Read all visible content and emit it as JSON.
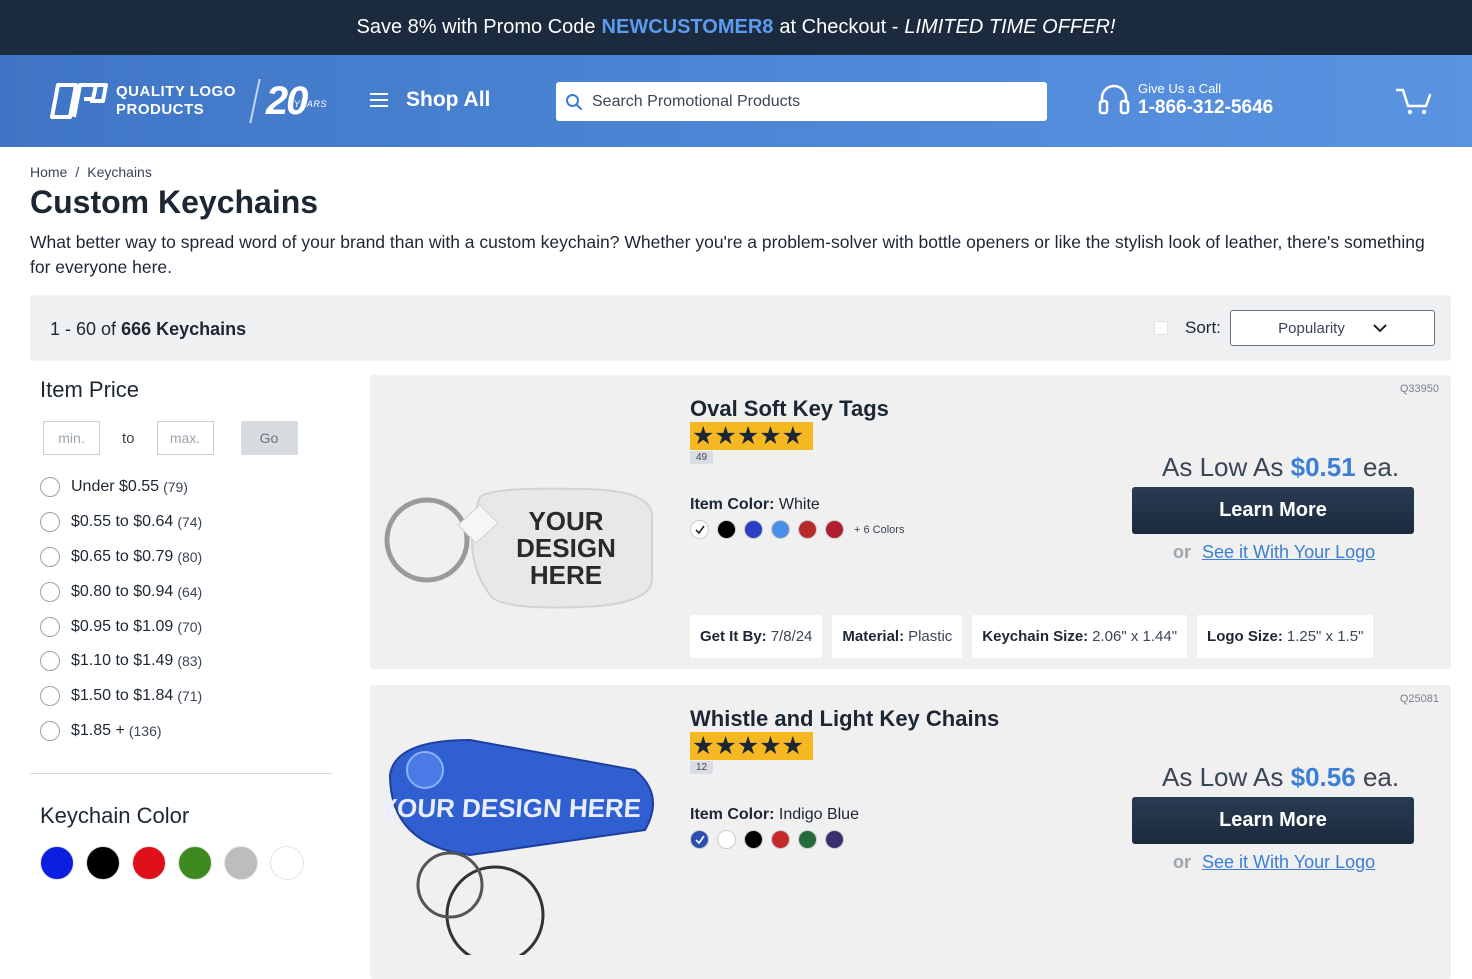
{
  "promo": {
    "prefix": "Save 8% with Promo Code",
    "code": "NEWCUSTOMER8",
    "middle": "at Checkout -",
    "offer": "LIMITED TIME OFFER!"
  },
  "header": {
    "logo_line1": "QUALITY LOGO",
    "logo_line2": "PRODUCTS",
    "logo_20": "20",
    "logo_years": "YEARS",
    "shop_all": "Shop All",
    "search_placeholder": "Search Promotional Products",
    "call_label": "Give Us a Call",
    "phone": "1-866-312-5646"
  },
  "breadcrumb": [
    "Home",
    "Keychains"
  ],
  "page": {
    "title": "Custom Keychains",
    "description": "What better way to spread word of your brand than with a custom keychain? Whether you're a problem-solver with bottle openers or like the stylish look of leather, there's something for everyone here."
  },
  "results": {
    "range": "1 - 60 of",
    "total": "666 Keychains",
    "sort_label": "Sort:",
    "sort_value": "Popularity"
  },
  "filters": {
    "price_title": "Item Price",
    "min_placeholder": "min.",
    "to": "to",
    "max_placeholder": "max.",
    "go": "Go",
    "price_ranges": [
      {
        "label": "Under $0.55",
        "count": "(79)"
      },
      {
        "label": "$0.55 to $0.64",
        "count": "(74)"
      },
      {
        "label": "$0.65 to $0.79",
        "count": "(80)"
      },
      {
        "label": "$0.80 to $0.94",
        "count": "(64)"
      },
      {
        "label": "$0.95 to $1.09",
        "count": "(70)"
      },
      {
        "label": "$1.10 to $1.49",
        "count": "(83)"
      },
      {
        "label": "$1.50 to $1.84",
        "count": "(71)"
      },
      {
        "label": "$1.85 +",
        "count": "(136)"
      }
    ],
    "color_title": "Keychain Color",
    "color_swatches": [
      "#0a1fe0",
      "#000000",
      "#e0101a",
      "#3f8a1e",
      "#bdbdbd",
      "#ffffff"
    ]
  },
  "products": [
    {
      "sku": "Q33950",
      "title": "Oval Soft Key Tags",
      "stars": "★★★★★",
      "reviews": "49",
      "item_color_label": "Item Color:",
      "item_color_value": "White",
      "swatches": [
        "#ffffff",
        "#000000",
        "#2b3fc4",
        "#4a8ee8",
        "#b52a2a",
        "#b01f2e"
      ],
      "more_colors": "+ 6 Colors",
      "price_prefix": "As Low As",
      "price": "$0.51",
      "price_suffix": "ea.",
      "learn_more": "Learn More",
      "or": "or",
      "see_logo": "See it With Your Logo",
      "image_text": "YOUR DESIGN HERE",
      "specs": [
        {
          "label": "Get It By:",
          "value": "7/8/24"
        },
        {
          "label": "Material:",
          "value": "Plastic"
        },
        {
          "label": "Keychain Size:",
          "value": "2.06\" x 1.44\""
        },
        {
          "label": "Logo Size:",
          "value": "1.25\" x 1.5\""
        }
      ]
    },
    {
      "sku": "Q25081",
      "title": "Whistle and Light Key Chains",
      "stars": "★★★★★",
      "reviews": "12",
      "item_color_label": "Item Color:",
      "item_color_value": "Indigo Blue",
      "swatches": [
        "#2b4fae",
        "#ffffff",
        "#000000",
        "#c42a2a",
        "#256a3c",
        "#3b2e6e"
      ],
      "price_prefix": "As Low As",
      "price": "$0.56",
      "price_suffix": "ea.",
      "learn_more": "Learn More",
      "or": "or",
      "see_logo": "See it With Your Logo",
      "image_text": "YOUR DESIGN HERE"
    }
  ]
}
